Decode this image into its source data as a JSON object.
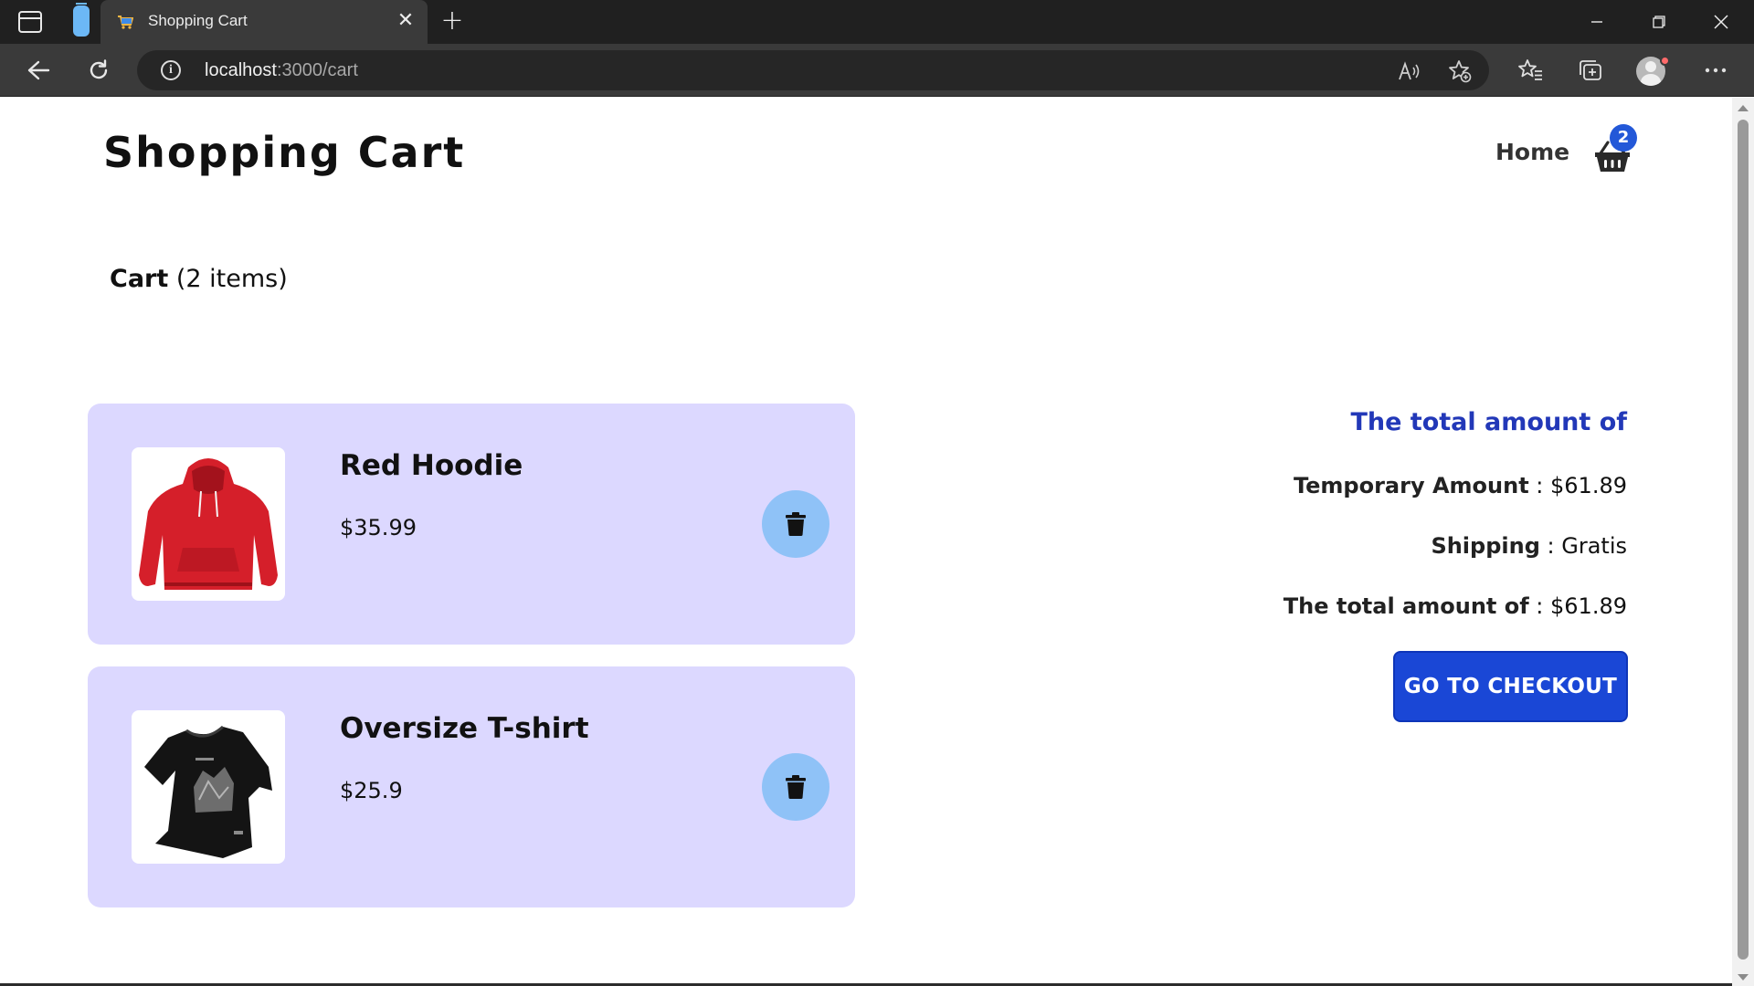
{
  "browser": {
    "tab_title": "Shopping Cart",
    "url_host": "localhost",
    "url_rest": ":3000/cart"
  },
  "header": {
    "site_title": "Shopping Cart",
    "home_link": "Home",
    "cart_count": "2"
  },
  "cart": {
    "label": "Cart",
    "items_text": "(2 items)",
    "items": [
      {
        "name": "Red Hoodie",
        "price": "$35.99",
        "image": "red-hoodie"
      },
      {
        "name": "Oversize T-shirt",
        "price": "$25.9",
        "image": "black-oversize-tshirt"
      }
    ]
  },
  "summary": {
    "title": "The total amount of",
    "temporary_label": "Temporary Amount",
    "temporary_value": " : $61.89",
    "shipping_label": "Shipping",
    "shipping_value": " : Gratis",
    "total_label": "The total amount of",
    "total_value": " : $61.89",
    "checkout_label": "GO TO CHECKOUT"
  },
  "colors": {
    "accent": "#1a47d6",
    "summary_title": "#2238b8",
    "card_bg": "#dcd8ff",
    "delete_bg": "#8fc2f7",
    "badge": "#2358d8"
  },
  "icons": [
    "tab-actions-icon",
    "workspaces-icon",
    "cart-favicon",
    "close-icon",
    "plus-icon",
    "minimize-icon",
    "restore-icon",
    "back-icon",
    "refresh-icon",
    "info-icon",
    "read-aloud-icon",
    "add-favorite-icon",
    "favorites-icon",
    "collections-icon",
    "more-icon",
    "basket-icon",
    "trash-icon"
  ]
}
